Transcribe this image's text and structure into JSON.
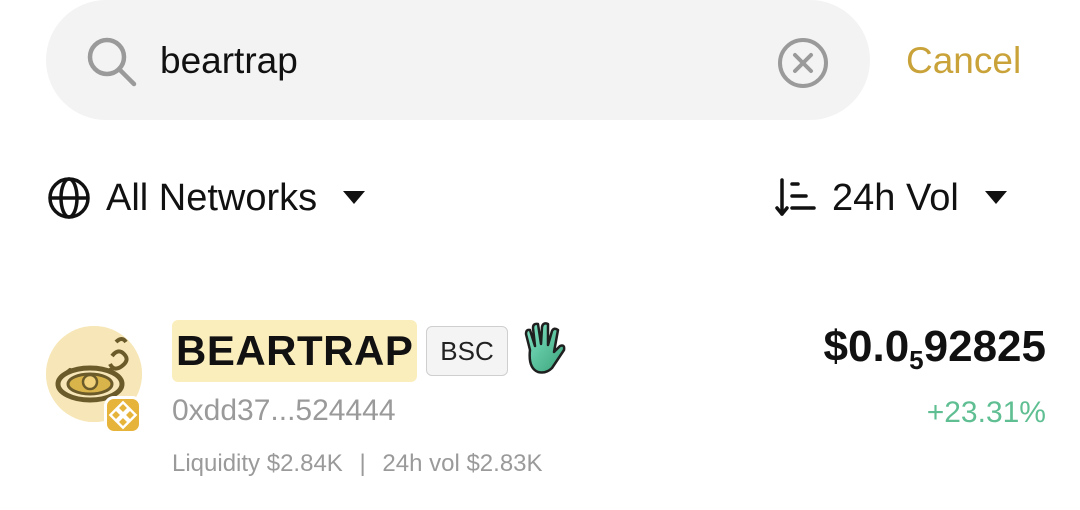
{
  "search": {
    "value": "beartrap",
    "cancel_label": "Cancel"
  },
  "filters": {
    "network_label": "All Networks",
    "sort_label": "24h Vol"
  },
  "results": [
    {
      "name": "BEARTRAP",
      "network_badge": "BSC",
      "address": "0xdd37...524444",
      "price_prefix": "$0.0",
      "price_zero_count": "5",
      "price_digits": "92825",
      "change": "+23.31%",
      "liquidity_label": "Liquidity",
      "liquidity_value": "$2.84K",
      "volume_label": "24h vol",
      "volume_value": "$2.83K",
      "stats_separator": "|"
    }
  ],
  "colors": {
    "accent": "#c9a33a",
    "positive": "#5fbf93",
    "muted_text": "#9a9a9a",
    "search_bg": "#f3f3f3",
    "highlight": "#fbeebd"
  },
  "icons": {
    "search": "search-icon",
    "clear": "clear-icon",
    "globe": "globe-icon",
    "caret": "caret-down-icon",
    "sort": "sort-icon",
    "hand": "hand-icon",
    "chain": "bnb-chain-icon"
  }
}
